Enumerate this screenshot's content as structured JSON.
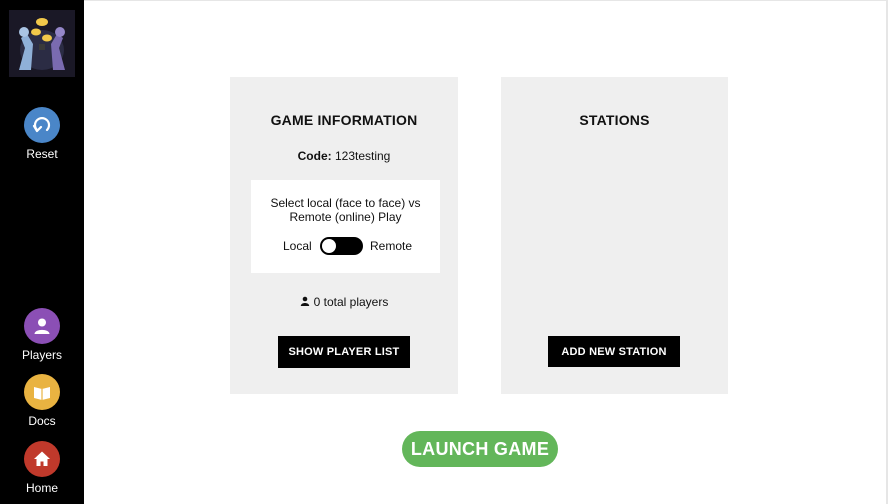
{
  "sidebar": {
    "logo_alt": "",
    "items": [
      {
        "label": "Reset",
        "icon": "reset-icon",
        "color": "#4a86c8"
      },
      {
        "label": "Players",
        "icon": "person-icon",
        "color": "#8b4fb5"
      },
      {
        "label": "Docs",
        "icon": "book-icon",
        "color": "#e9b341"
      },
      {
        "label": "Home",
        "icon": "home-icon",
        "color": "#c0392b"
      }
    ]
  },
  "game_info": {
    "title": "GAME INFORMATION",
    "code_label": "Code:",
    "code_value": "123testing",
    "mode_description": "Select local (face to face) vs Remote (online) Play",
    "toggle_left_label": "Local",
    "toggle_right_label": "Remote",
    "toggle_state": "Local",
    "players_text": "0 total players",
    "show_players_button": "SHOW PLAYER LIST"
  },
  "stations": {
    "title": "STATIONS",
    "add_station_button": "ADD NEW STATION"
  },
  "launch_button": "LAUNCH GAME",
  "colors": {
    "sidebar": "#000000",
    "panel": "#efefef",
    "launch": "#63b65a",
    "button": "#000000"
  }
}
